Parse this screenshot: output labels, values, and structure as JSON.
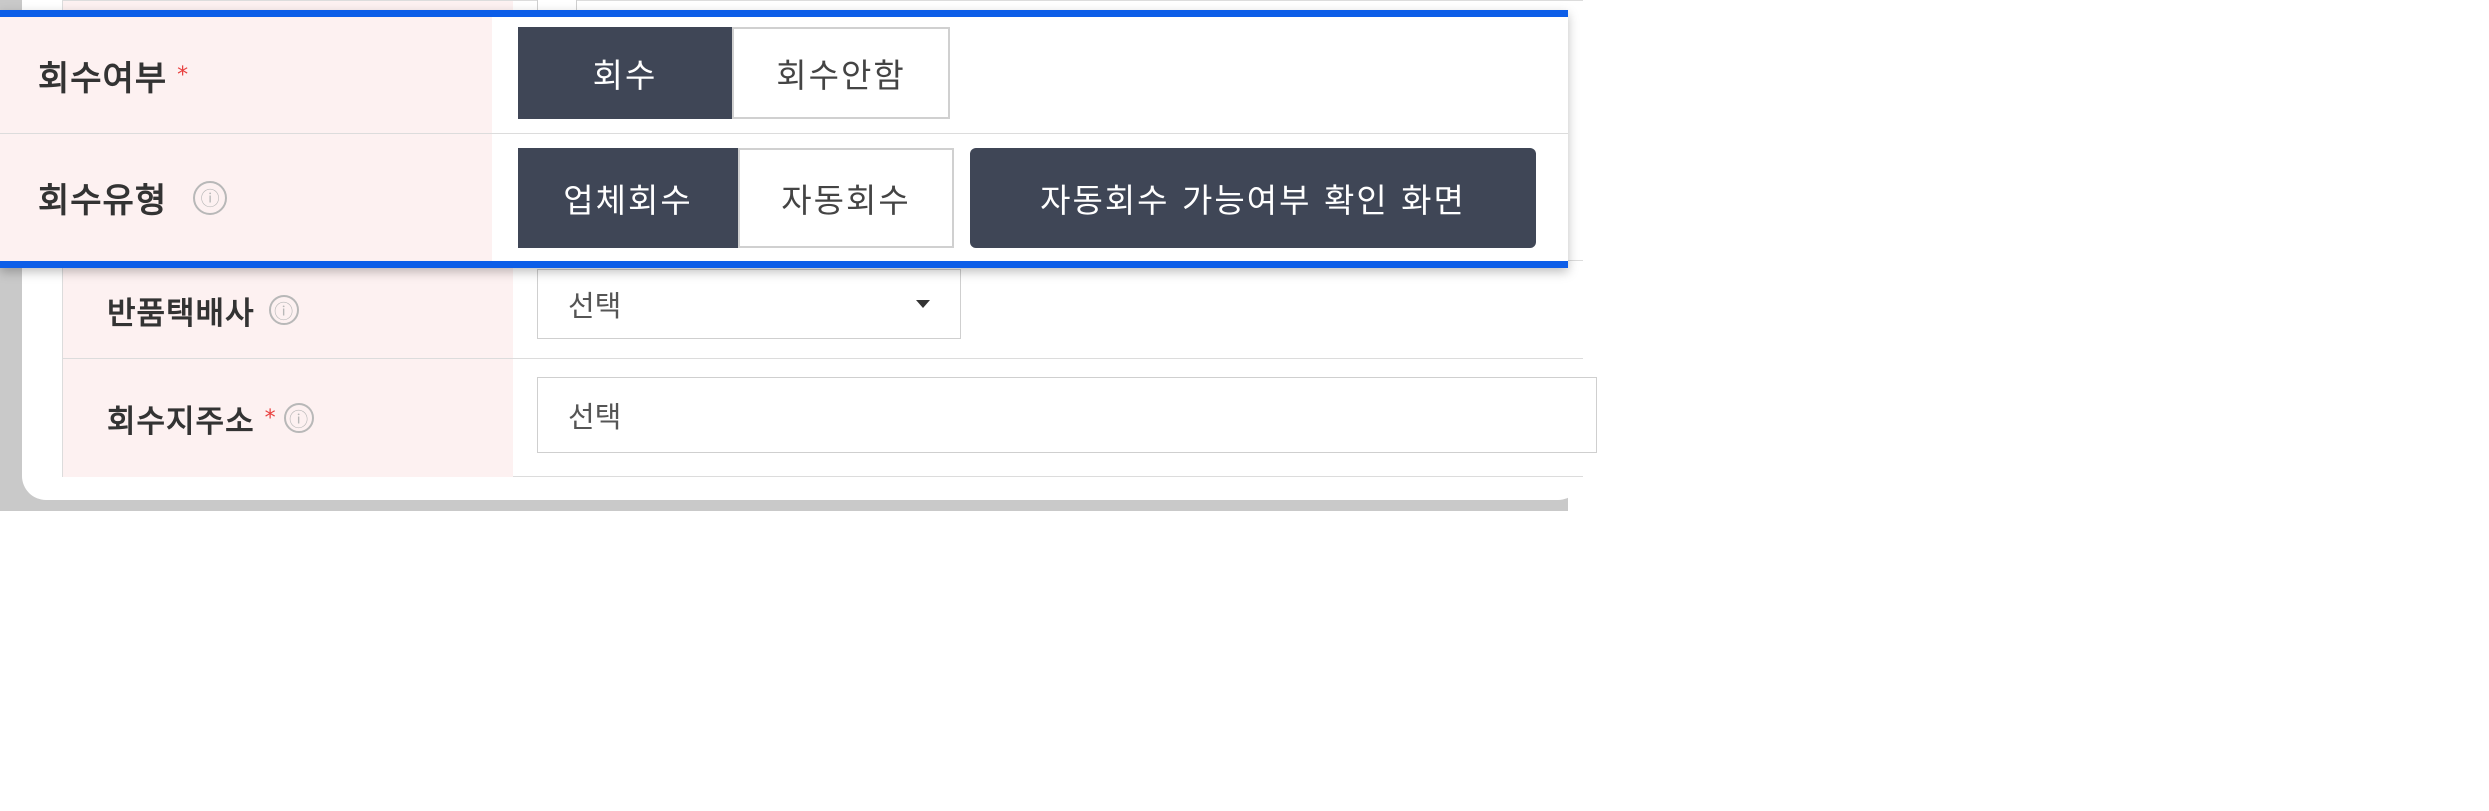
{
  "collection": {
    "label": "회수여부",
    "required_mark": "*",
    "options": [
      "회수",
      "회수안함"
    ]
  },
  "collection_type": {
    "label": "회수유형",
    "info_icon": "ⓘ",
    "options": [
      "업체회수",
      "자동회수"
    ],
    "check_button": "자동회수 가능여부 확인 화면"
  },
  "return_courier": {
    "label": "반품택배사",
    "info_icon": "ⓘ",
    "select_value": "선택"
  },
  "collection_address": {
    "label": "회수지주소",
    "required_mark": "*",
    "info_icon": "ⓘ",
    "select_value": "선택"
  },
  "colors": {
    "highlight_border": "#0d5ee8",
    "active_segment": "#3f4656",
    "label_background": "#fdf1f1",
    "required": "#e8413f"
  }
}
